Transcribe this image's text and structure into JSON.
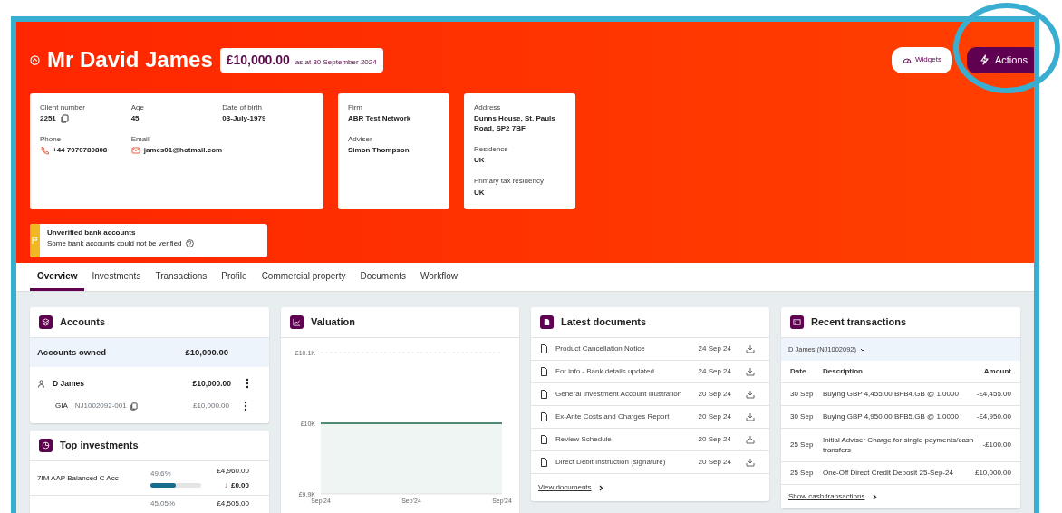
{
  "header": {
    "name": "Mr David James",
    "balance": "£10,000.00",
    "balance_date": "as at 30 September 2024",
    "buttons": [
      {
        "label": "Widgets",
        "kind": "secondary"
      },
      {
        "label": "Actions",
        "kind": "primary"
      }
    ]
  },
  "info_cards": [
    {
      "fields": [
        {
          "label": "Client number",
          "value": "2251",
          "kind": "copy"
        },
        {
          "label": "Age",
          "value": "45",
          "kind": "plain"
        },
        {
          "label": "Date of birth",
          "value": "03-July-1979",
          "kind": "plain"
        },
        {
          "label": "Phone",
          "value": "+44 7070780808",
          "kind": "phone"
        },
        {
          "label": "Email",
          "value": "james01@hotmail.com",
          "kind": "email"
        }
      ]
    },
    {
      "fields": [
        {
          "label": "Firm",
          "value": "ABR Test Network",
          "kind": "plain"
        },
        {
          "label": "Adviser",
          "value": "Simon Thompson",
          "kind": "plain"
        }
      ]
    },
    {
      "fields": [
        {
          "label": "Address",
          "value": "Dunns House, St. Pauls Road, SP2 7BF",
          "kind": "plain"
        },
        {
          "label": "Residence",
          "value": "UK",
          "kind": "plain"
        },
        {
          "label": "Primary tax residency",
          "value": "UK",
          "kind": "plain"
        }
      ]
    }
  ],
  "alert": {
    "title": "Unverified bank accounts",
    "text": "Some bank accounts could not be verified"
  },
  "tabs": [
    {
      "label": "Overview",
      "selected": true
    },
    {
      "label": "Investments",
      "selected": false
    },
    {
      "label": "Transactions",
      "selected": false
    },
    {
      "label": "Profile",
      "selected": false
    },
    {
      "label": "Commercial property",
      "selected": false
    },
    {
      "label": "Documents",
      "selected": false
    },
    {
      "label": "Workflow",
      "selected": false
    }
  ],
  "accounts": {
    "title": "Accounts",
    "summary_label": "Accounts owned",
    "summary_value": "£10,000.00",
    "owner": {
      "name": "D James",
      "value": "£10,000.00"
    },
    "account": {
      "type": "GIA",
      "number": "NJ1002092-001",
      "value": "£10,000.00"
    }
  },
  "top_investments": {
    "title": "Top investments",
    "rows": [
      {
        "name": "7IM AAP Balanced C Acc",
        "percent": "49.6%",
        "level": 0.496,
        "value": "£4,960.00",
        "change": "£0.00",
        "trend": "↓"
      },
      {
        "percent": "45.05%",
        "value": "£4,505.00"
      }
    ]
  },
  "valuation": {
    "title": "Valuation",
    "chart_data": {
      "type": "area",
      "categories": [
        "Sep'24",
        "Sep'24",
        "Sep'24"
      ],
      "series": [
        {
          "color": "#1e6b4a",
          "values": [
            10000,
            10000,
            10000
          ]
        }
      ],
      "ylim": [
        9900,
        10100
      ],
      "yticks": [
        {
          "value": 10100,
          "label": "£10.1K"
        },
        {
          "value": 10000,
          "label": "£10K"
        },
        {
          "value": 9900,
          "label": "£9.9K"
        }
      ]
    }
  },
  "documents": {
    "title": "Latest documents",
    "items": [
      {
        "name": "Product Cancellation Notice",
        "date": "24 Sep 24"
      },
      {
        "name": "For info - Bank details updated",
        "date": "24 Sep 24"
      },
      {
        "name": "General Investment Account Illustration",
        "date": "20 Sep 24"
      },
      {
        "name": "Ex-Ante Costs and Charges Report",
        "date": "20 Sep 24"
      },
      {
        "name": "Review Schedule",
        "date": "20 Sep 24"
      },
      {
        "name": "Direct Debit Instruction (signature)",
        "date": "20 Sep 24"
      }
    ],
    "link": "View documents"
  },
  "transactions": {
    "title": "Recent transactions",
    "account": "D James (NJ1002092)",
    "columns": [
      "Date",
      "Description",
      "Amount"
    ],
    "rows": [
      {
        "date": "30 Sep",
        "description": "Buying GBP 4,455.00 BFB4.GB @ 1.0000",
        "amount": "-£4,455.00"
      },
      {
        "date": "30 Sep",
        "description": "Buying GBP 4,950.00 BFB5.GB @ 1.0000",
        "amount": "-£4,950.00"
      },
      {
        "date": "25 Sep",
        "description": "Initial Adviser Charge for single payments/cash transfers",
        "amount": "-£100.00"
      },
      {
        "date": "25 Sep",
        "description": "One-Off Direct Credit Deposit 25-Sep-24",
        "amount": "£10,000.00"
      }
    ],
    "link": "Show cash transactions"
  }
}
